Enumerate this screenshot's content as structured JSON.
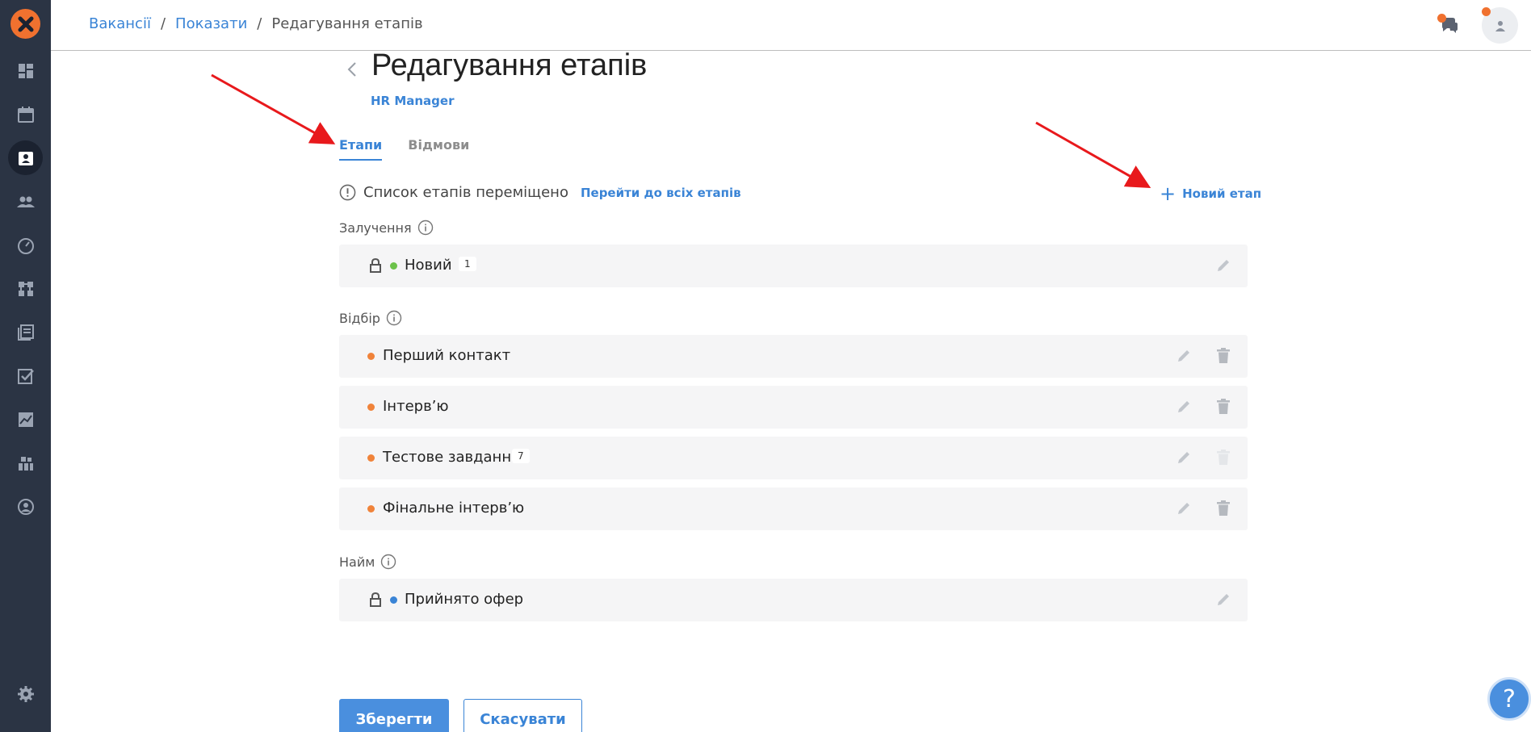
{
  "breadcrumb": {
    "items": [
      "Вакансії",
      "Показати"
    ],
    "current": "Редагування етапів"
  },
  "page": {
    "title": "Редагування етапів",
    "subtitle": "HR Manager"
  },
  "tabs": [
    {
      "label": "Етапи",
      "active": true
    },
    {
      "label": "Відмови",
      "active": false
    }
  ],
  "notice": {
    "text": "Список етапів переміщено",
    "link": "Перейти до всіх етапів"
  },
  "new_stage_label": "Новий етап",
  "groups": {
    "engagement": {
      "label": "Залучення",
      "rows": [
        {
          "label": "Новий",
          "count": "1",
          "dot_color": "#6cc24a",
          "locked": true
        }
      ]
    },
    "selection": {
      "label": "Відбір",
      "rows": [
        {
          "label": "Перший контакт",
          "dot_color": "#f0833a"
        },
        {
          "label": "Інтерв’ю",
          "dot_color": "#f0833a"
        },
        {
          "label": "Тестове завдання",
          "count": "7",
          "dot_color": "#f0833a"
        },
        {
          "label": "Фінальне інтерв’ю",
          "dot_color": "#f0833a"
        }
      ]
    },
    "hire": {
      "label": "Найм",
      "rows": [
        {
          "label": "Прийнято офер",
          "dot_color": "#3a84d6",
          "locked": true
        }
      ]
    }
  },
  "buttons": {
    "save": "Зберегти",
    "cancel": "Скасувати"
  },
  "help_label": "?",
  "colors": {
    "accent": "#3a84d6",
    "sidebar": "#2b3444",
    "brand": "#f0712f"
  }
}
